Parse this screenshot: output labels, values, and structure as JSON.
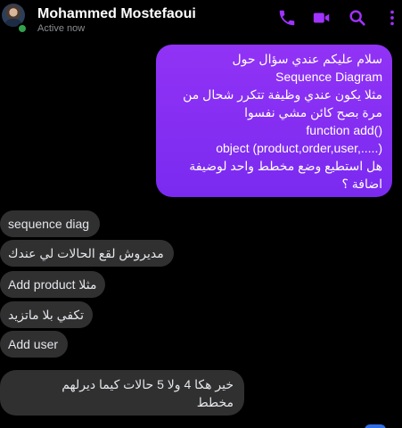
{
  "header": {
    "name": "Mohammed Mostefaoui",
    "status": "Active now",
    "icons": [
      "phone-icon",
      "video-icon",
      "search-icon",
      "more-options-icon"
    ],
    "accent_color": "#a033ff"
  },
  "messages": {
    "sent_1": {
      "lines": [
        "سلام عليكم عندي سؤال حول",
        "Sequence Diagram",
        "مثلا يكون عندي وظيفة تتكرر شحال من",
        "مرة بصح كائن مشي نفسوا",
        "function add()",
        "object (product,order,user,.....)",
        "هل استطيع وضع مخطط واحد لوضيفة",
        "اضافة ؟"
      ]
    },
    "recv_1": "sequence diag",
    "recv_2": "مديروش لقع الحالات لي عندك",
    "recv_3": "Add product مثلا",
    "recv_4": "تكفي بلا ماتزيد",
    "recv_5": "Add user",
    "recv_6": {
      "lines": [
        "خير  هكا 4 ولا 5 حالات كيما ديرلهم",
        "مخطط"
      ]
    }
  }
}
